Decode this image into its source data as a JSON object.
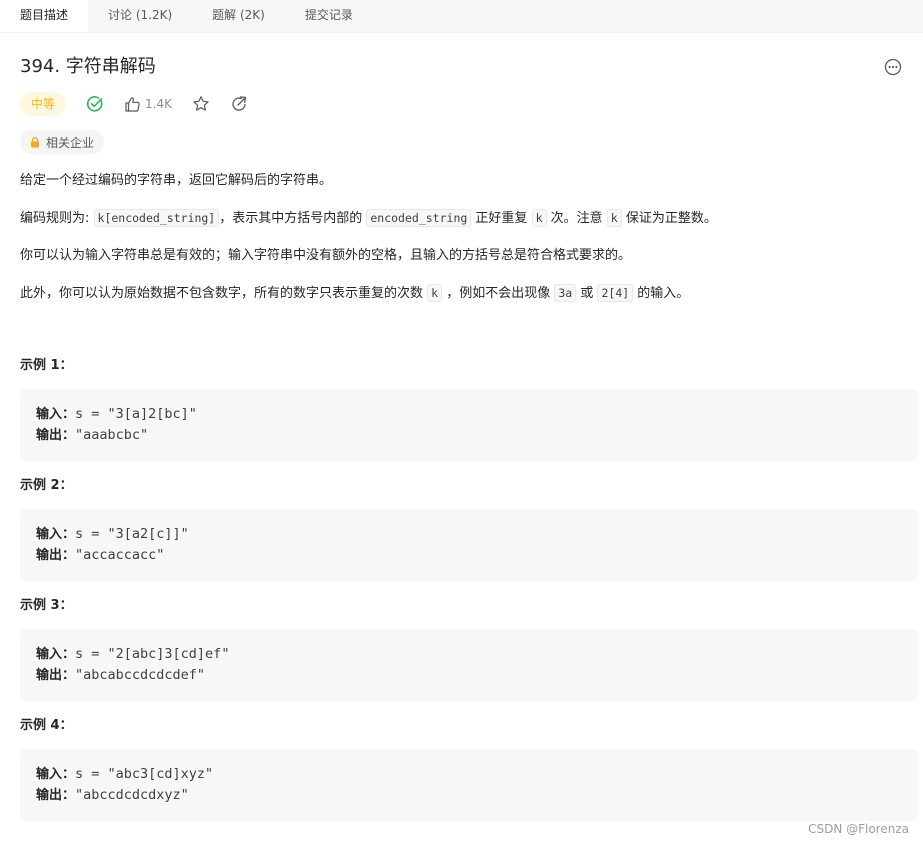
{
  "tabs": [
    {
      "label": "题目描述"
    },
    {
      "label": "讨论 (1.2K)"
    },
    {
      "label": "题解 (2K)"
    },
    {
      "label": "提交记录"
    }
  ],
  "problem": {
    "title": "394. 字符串解码",
    "difficulty": "中等",
    "likes": "1.4K",
    "company_tag": "相关企业"
  },
  "description": {
    "p1": "给定一个经过编码的字符串，返回它解码后的字符串。",
    "p2_a": "编码规则为: ",
    "p2_code1": "k[encoded_string]",
    "p2_b": "，表示其中方括号内部的 ",
    "p2_code2": "encoded_string",
    "p2_c": " 正好重复 ",
    "p2_code3": "k",
    "p2_d": " 次。注意 ",
    "p2_code4": "k",
    "p2_e": " 保证为正整数。",
    "p3": "你可以认为输入字符串总是有效的；输入字符串中没有额外的空格，且输入的方括号总是符合格式要求的。",
    "p4_a": "此外，你可以认为原始数据不包含数字，所有的数字只表示重复的次数 ",
    "p4_code1": "k",
    "p4_b": " ，例如不会出现像 ",
    "p4_code2": "3a",
    "p4_c": " 或 ",
    "p4_code3": "2[4]",
    "p4_d": " 的输入。"
  },
  "examples": [
    {
      "title": "示例 1：",
      "input_label": "输入：",
      "input": "s = \"3[a]2[bc]\"",
      "output_label": "输出：",
      "output": "\"aaabcbc\""
    },
    {
      "title": "示例 2：",
      "input_label": "输入：",
      "input": "s = \"3[a2[c]]\"",
      "output_label": "输出：",
      "output": "\"accaccacc\""
    },
    {
      "title": "示例 3：",
      "input_label": "输入：",
      "input": "s = \"2[abc]3[cd]ef\"",
      "output_label": "输出：",
      "output": "\"abcabccdcdcdef\""
    },
    {
      "title": "示例 4：",
      "input_label": "输入：",
      "input": "s = \"abc3[cd]xyz\"",
      "output_label": "输出：",
      "output": "\"abccdcdcdxyz\""
    }
  ],
  "watermark": "CSDN @Florenza",
  "icons": {
    "more": "more-icon",
    "solved": "check-circle-icon",
    "like": "thumbs-up-icon",
    "favorite": "star-icon",
    "share": "share-icon",
    "lock": "lock-icon"
  },
  "colors": {
    "difficulty_text": "#ffb800",
    "difficulty_bg": "#fff7e0",
    "solved_green": "#2db55d",
    "lock_orange": "#ffa116"
  }
}
